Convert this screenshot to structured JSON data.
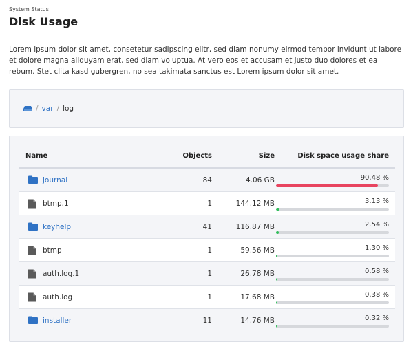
{
  "header": {
    "eyebrow": "System Status",
    "title": "Disk Usage",
    "intro": "Lorem ipsum dolor sit amet, consetetur sadipscing elitr, sed diam nonumy eirmod tempor invidunt ut labore et dolore magna aliquyam erat, sed diam voluptua. At vero eos et accusam et justo duo dolores et ea rebum. Stet clita kasd gubergren, no sea takimata sanctus est Lorem ipsum dolor sit amet."
  },
  "breadcrumb": {
    "root_icon": "hard-drive-icon",
    "separator": "/",
    "items": [
      {
        "label": "var",
        "link": true
      },
      {
        "label": "log",
        "link": false
      }
    ]
  },
  "table": {
    "columns": {
      "name": "Name",
      "objects": "Objects",
      "size": "Size",
      "share": "Disk space usage share"
    },
    "rows": [
      {
        "name": "journal",
        "type": "folder",
        "objects": "84",
        "size": "4.06 GB",
        "share_label": "90.48 %",
        "share": 0.9048
      },
      {
        "name": "btmp.1",
        "type": "file",
        "objects": "1",
        "size": "144.12 MB",
        "share_label": "3.13 %",
        "share": 0.0313
      },
      {
        "name": "keyhelp",
        "type": "folder",
        "objects": "41",
        "size": "116.87 MB",
        "share_label": "2.54 %",
        "share": 0.0254
      },
      {
        "name": "btmp",
        "type": "file",
        "objects": "1",
        "size": "59.56 MB",
        "share_label": "1.30 %",
        "share": 0.013
      },
      {
        "name": "auth.log.1",
        "type": "file",
        "objects": "1",
        "size": "26.78 MB",
        "share_label": "0.58 %",
        "share": 0.0058
      },
      {
        "name": "auth.log",
        "type": "file",
        "objects": "1",
        "size": "17.68 MB",
        "share_label": "0.38 %",
        "share": 0.0038
      },
      {
        "name": "installer",
        "type": "folder",
        "objects": "11",
        "size": "14.76 MB",
        "share_label": "0.32 %",
        "share": 0.0032
      }
    ]
  },
  "colors": {
    "link": "#2f72c4",
    "bar_high": "#e8445f",
    "bar_low": "#2fbf5a",
    "bar_track": "#d6d8dc",
    "folder_icon": "#2f72c4",
    "file_icon": "#5a5a5a"
  }
}
